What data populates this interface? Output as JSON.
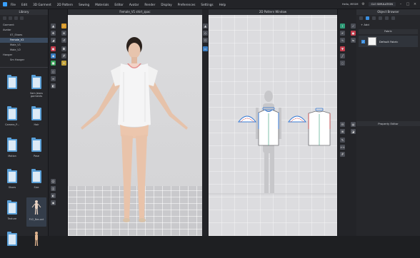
{
  "menubar": {
    "items": [
      "File",
      "Edit",
      "3D Garment",
      "2D Pattern",
      "Sewing",
      "Materials",
      "Editor",
      "Avatar",
      "Render",
      "Display",
      "Preferences",
      "Settings",
      "Help"
    ],
    "user": "Hello, MEGM",
    "brand": "CLO SIMULATION"
  },
  "library": {
    "title": "Library",
    "tree": [
      "Garment",
      "Avatar",
      "07_Shoes",
      "Female_V2",
      "Male_V1",
      "Male_V2",
      "Hanger",
      "Sm Hanger"
    ],
    "thumbs": [
      "",
      "Sam Jeans garments",
      "Camera_P...",
      "Hair",
      "Motion",
      "Pose",
      "Shoes",
      "Size",
      "Texture",
      "FV2_Bas.avt",
      "",
      ""
    ]
  },
  "view3d": {
    "title": "Female_V1 shirt_zpac"
  },
  "view2d": {
    "title": "2D Pattern Window"
  },
  "object_browser": {
    "title": "Object Browser",
    "add_label": "+ Add",
    "header": "Fabric",
    "fabric_name": "Default Fabric",
    "property_title": "Property Editor"
  },
  "colors": {
    "accent": "#3a8ee0",
    "folder": "#5aa0d8",
    "bg": "#1e1f22"
  }
}
